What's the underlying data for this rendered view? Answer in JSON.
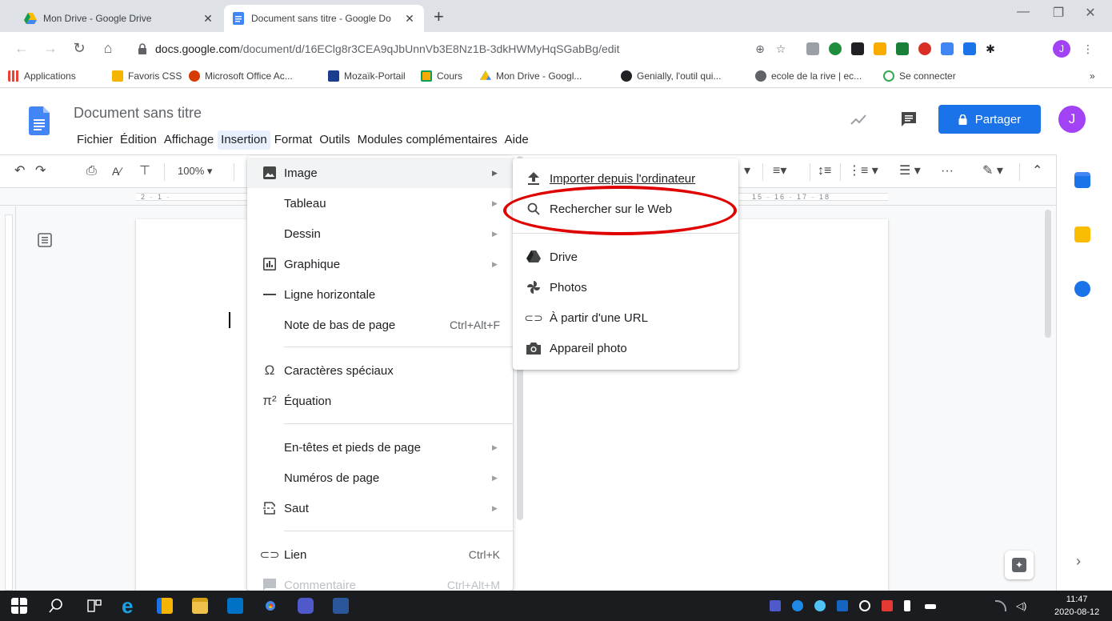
{
  "browser": {
    "tabs": [
      {
        "title": "Mon Drive - Google Drive",
        "active": false
      },
      {
        "title": "Document sans titre - Google Do",
        "active": true
      }
    ],
    "new_tab": "+",
    "url_host": "docs.google.com",
    "url_path": "/document/d/16EClg8r3CEA9qJbUnnVb3E8Nz1B-3dkHWMyHqSGabBg/edit",
    "profile_initial": "J",
    "bookmarks": [
      {
        "label": "Applications",
        "icon": "apps-grid-icon",
        "color": "#ea4335"
      },
      {
        "label": "Favoris CSS",
        "icon": "folder-icon",
        "color": "#f4b400"
      },
      {
        "label": "Microsoft Office Ac...",
        "icon": "office-icon",
        "color": "#d83b01"
      },
      {
        "label": "Mozaïk-Portail",
        "icon": "mozaik-icon",
        "color": "#1a3d8f"
      },
      {
        "label": "Cours",
        "icon": "classroom-icon",
        "color": "#0f9d58"
      },
      {
        "label": "Mon Drive - Googl...",
        "icon": "drive-icon",
        "color": "#4285f4"
      },
      {
        "label": "Genially, l'outil qui...",
        "icon": "genially-icon",
        "color": "#202124"
      },
      {
        "label": "ecole de la rive | ec...",
        "icon": "globe-icon",
        "color": "#5f6368"
      },
      {
        "label": "Se connecter",
        "icon": "connect-icon",
        "color": "#34a853"
      }
    ],
    "bookmarks_more": "»"
  },
  "docs": {
    "title": "Document sans titre",
    "menus": [
      "Fichier",
      "Édition",
      "Affichage",
      "Insertion",
      "Format",
      "Outils",
      "Modules complémentaires",
      "Aide"
    ],
    "share_label": "Partager",
    "user_initial": "J",
    "zoom": "100%",
    "ruler_left": "2 · 1 ·",
    "ruler_right": "15 ·  16 ·  17 ·  18",
    "accent": "#1a73e8"
  },
  "insert_menu": {
    "items": [
      {
        "label": "Image",
        "icon": "image-icon",
        "submenu": true
      },
      {
        "label": "Tableau",
        "submenu": true
      },
      {
        "label": "Dessin",
        "submenu": true
      },
      {
        "label": "Graphique",
        "icon": "chart-icon",
        "submenu": true
      },
      {
        "label": "Ligne horizontale",
        "icon": "horizontal-line-icon"
      },
      {
        "label": "Note de bas de page",
        "shortcut": "Ctrl+Alt+F"
      },
      {
        "label": "Caractères spéciaux",
        "icon": "omega-icon"
      },
      {
        "label": "Équation",
        "icon": "pi-icon"
      },
      {
        "label": "En-têtes et pieds de page",
        "submenu": true
      },
      {
        "label": "Numéros de page",
        "submenu": true
      },
      {
        "label": "Saut",
        "icon": "page-break-icon",
        "submenu": true
      },
      {
        "label": "Lien",
        "icon": "link-icon",
        "shortcut": "Ctrl+K"
      },
      {
        "label": "Commentaire",
        "icon": "comment-icon",
        "shortcut": "Ctrl+Alt+M",
        "disabled": true
      }
    ]
  },
  "image_submenu": {
    "items": [
      {
        "label": "Importer depuis l'ordinateur",
        "icon": "upload-icon"
      },
      {
        "label": "Rechercher sur le Web",
        "icon": "search-icon",
        "highlighted": true
      },
      {
        "label": "Drive",
        "icon": "drive-icon"
      },
      {
        "label": "Photos",
        "icon": "photos-icon"
      },
      {
        "label": "À partir d'une URL",
        "icon": "link-icon"
      },
      {
        "label": "Appareil photo",
        "icon": "camera-icon"
      }
    ]
  },
  "taskbar": {
    "time": "11:47",
    "date": "2020-08-12"
  }
}
